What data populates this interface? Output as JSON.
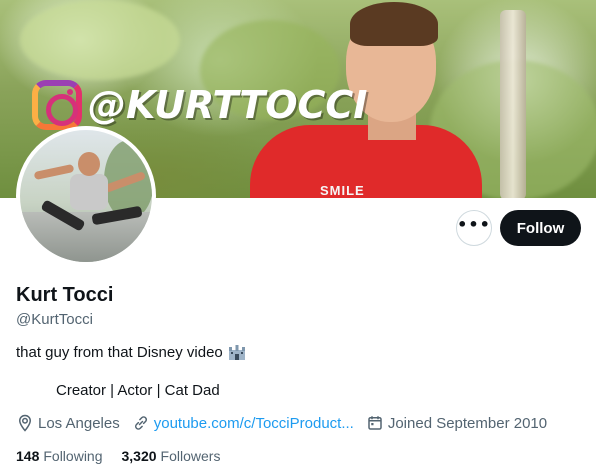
{
  "banner": {
    "instagram_handle": "@KURTTOCCI",
    "shirt_text": "SMILE"
  },
  "profile": {
    "display_name": "Kurt Tocci",
    "username": "@KurtTocci",
    "bio_line1": "that guy from that Disney video",
    "bio_line2": "Creator | Actor | Cat Dad",
    "location": "Los Angeles",
    "website": "youtube.com/c/TocciProduct...",
    "joined": "Joined September 2010"
  },
  "actions": {
    "more_label": "•••",
    "follow_label": "Follow"
  },
  "stats": {
    "following_count": "148",
    "following_label": "Following",
    "followers_count": "3,320",
    "followers_label": "Followers"
  },
  "icons": {
    "location": "location-pin-icon",
    "link": "link-icon",
    "calendar": "calendar-icon",
    "more": "more-dots-icon",
    "castle": "castle-emoji-icon",
    "instagram": "instagram-logo-icon"
  },
  "colors": {
    "follow_bg": "#0f1419",
    "link": "#1d9bf0",
    "secondary_text": "#536471",
    "shirt": "#e02a2a"
  }
}
